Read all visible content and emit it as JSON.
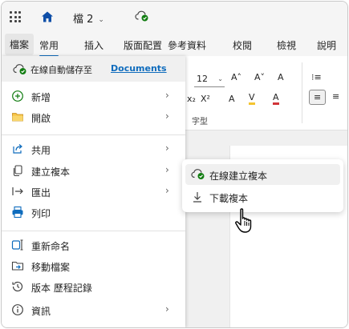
{
  "titlebar": {
    "doc_name": "檔 2",
    "caret": "⌄"
  },
  "tabs": [
    {
      "label": "檔案"
    },
    {
      "label": "常用"
    },
    {
      "label": "插入"
    },
    {
      "label": "版面配置"
    },
    {
      "label": "參考資料"
    },
    {
      "label": "校閱"
    },
    {
      "label": "檢視"
    },
    {
      "label": "說明"
    }
  ],
  "ribbon": {
    "font_size": "12",
    "font_size_caret": "⌄",
    "group_label": "字型",
    "buttons": {
      "grow_font": "A˄",
      "shrink_font": "A˅",
      "clear_format": "A",
      "subscript": "x₂",
      "superscript": "X²",
      "highlight": "ᐯ",
      "font_color": "A",
      "bullets": "⁝≡",
      "align": "≡"
    },
    "colors": {
      "highlight": "#f4c430",
      "font_color": "#d13438"
    }
  },
  "menu": {
    "autosave_label": "在線自動儲存至",
    "autosave_link": "Documents",
    "items": [
      {
        "label": "新增",
        "icon": "plus-circle-icon",
        "has_submenu": true
      },
      {
        "label": "開啟",
        "icon": "folder-icon",
        "has_submenu": true
      },
      {
        "label": "共用",
        "icon": "share-icon",
        "has_submenu": true
      },
      {
        "label": "建立複本",
        "icon": "copy-icon",
        "has_submenu": true
      },
      {
        "label": "匯出",
        "icon": "export-icon",
        "has_submenu": true
      },
      {
        "label": "列印",
        "icon": "print-icon",
        "has_submenu": false
      },
      {
        "label": "重新命名",
        "icon": "rename-icon",
        "has_submenu": false
      },
      {
        "label": "移動檔案",
        "icon": "move-folder-icon",
        "has_submenu": false
      },
      {
        "label": "版本 歷程記錄",
        "icon": "history-icon",
        "has_submenu": false
      },
      {
        "label": "資訊",
        "icon": "info-icon",
        "has_submenu": true
      }
    ],
    "chevron": "›"
  },
  "submenu": {
    "items": [
      {
        "label": "在線建立複本",
        "icon": "cloud-sync-icon"
      },
      {
        "label": "下載複本",
        "icon": "download-icon"
      }
    ]
  },
  "colors": {
    "accent": "#0f6cbd",
    "sync_green": "#107c10"
  }
}
